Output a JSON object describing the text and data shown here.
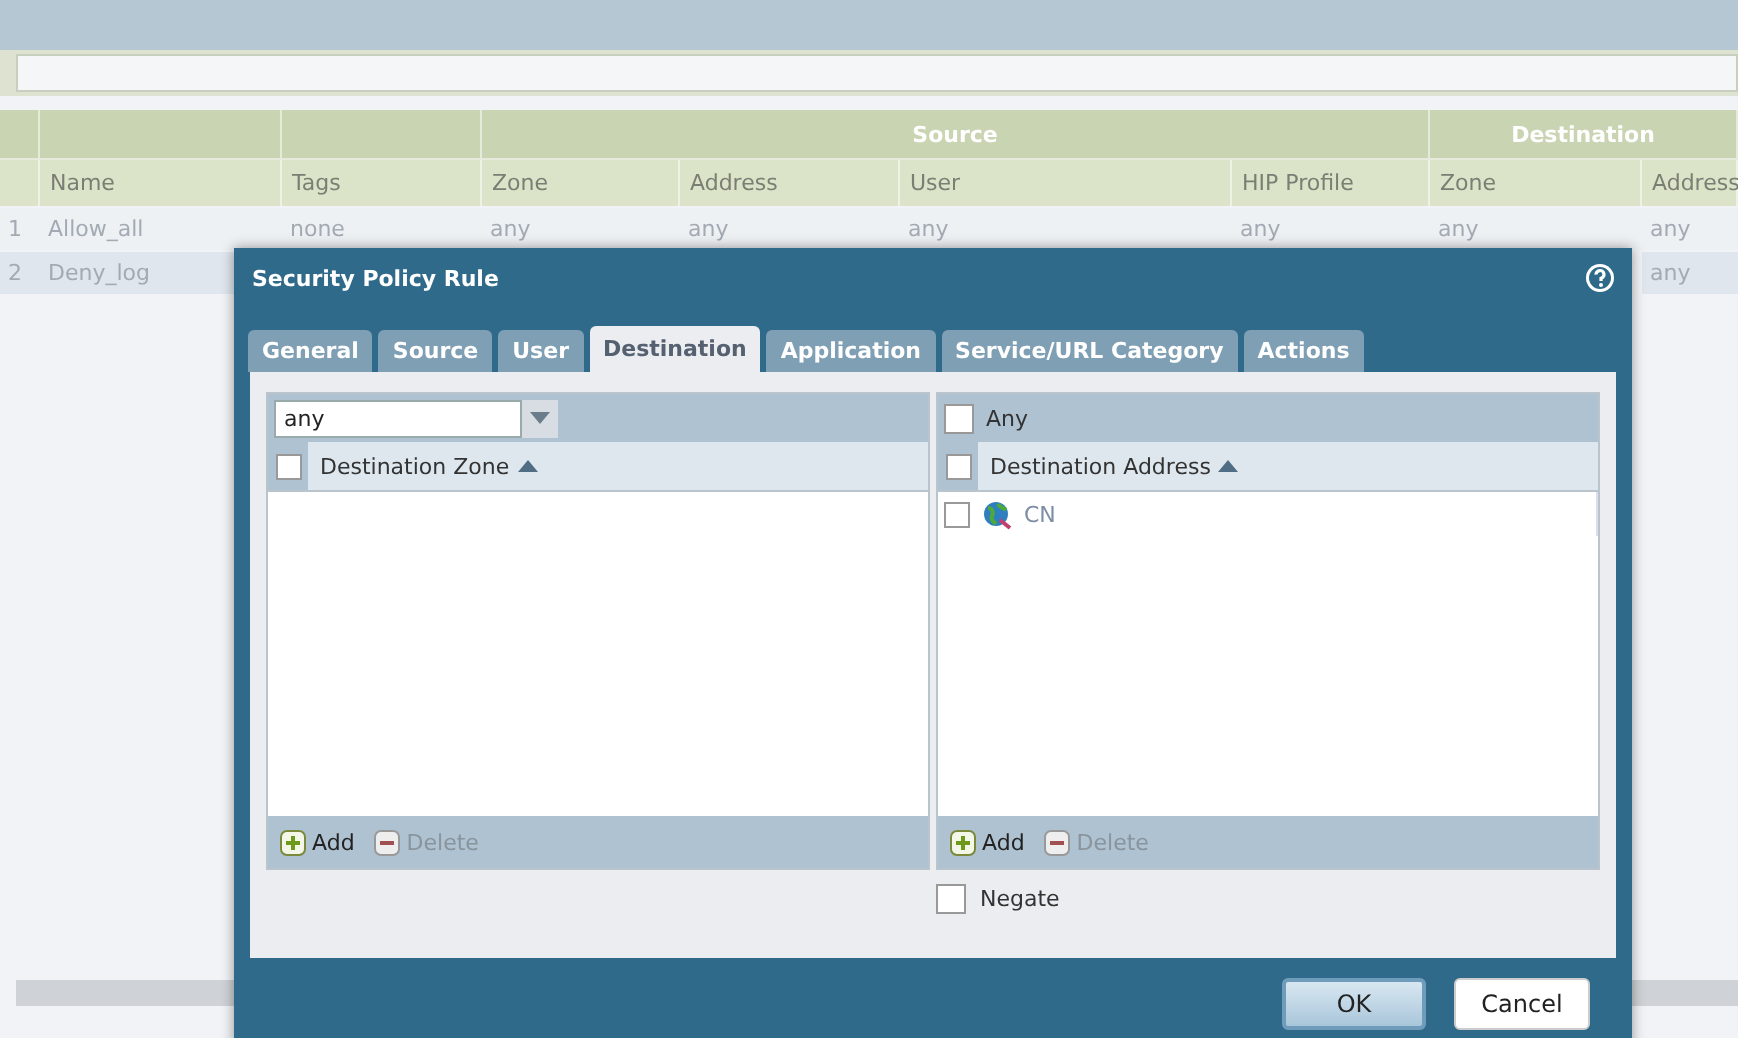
{
  "table": {
    "columns": [
      "Name",
      "Tags"
    ],
    "groups": [
      {
        "label": "Source",
        "columns": [
          "Zone",
          "Address",
          "User",
          "HIP Profile"
        ]
      },
      {
        "label": "Destination",
        "columns": [
          "Zone",
          "Address"
        ]
      }
    ],
    "rows": [
      {
        "number": "1",
        "selected": false,
        "cells": [
          "Allow_all",
          "none",
          "any",
          "any",
          "any",
          "any",
          "any",
          "any"
        ]
      },
      {
        "number": "2",
        "selected": true,
        "cells": [
          "Deny_log",
          null,
          null,
          null,
          null,
          null,
          null,
          "any"
        ]
      }
    ]
  },
  "dialog": {
    "title": "Security Policy Rule",
    "tabs": [
      {
        "label": "General",
        "selected": false
      },
      {
        "label": "Source",
        "selected": false
      },
      {
        "label": "User",
        "selected": false
      },
      {
        "label": "Destination",
        "selected": true
      },
      {
        "label": "Application",
        "selected": false
      },
      {
        "label": "Service/URL Category",
        "selected": false
      },
      {
        "label": "Actions",
        "selected": false
      }
    ],
    "zone_panel": {
      "select_value": "any",
      "header": "Destination Zone",
      "header_checked": false,
      "add": "Add",
      "delete": "Delete"
    },
    "address_panel": {
      "any_label": "Any",
      "any_checked": false,
      "header": "Destination Address",
      "header_checked": false,
      "items": [
        {
          "label": "CN",
          "checked": false
        }
      ],
      "add": "Add",
      "delete": "Delete"
    },
    "negate": {
      "label": "Negate",
      "checked": false
    },
    "buttons": [
      {
        "label": "OK",
        "kind": "primary"
      },
      {
        "label": "Cancel",
        "kind": "secondary"
      }
    ]
  }
}
